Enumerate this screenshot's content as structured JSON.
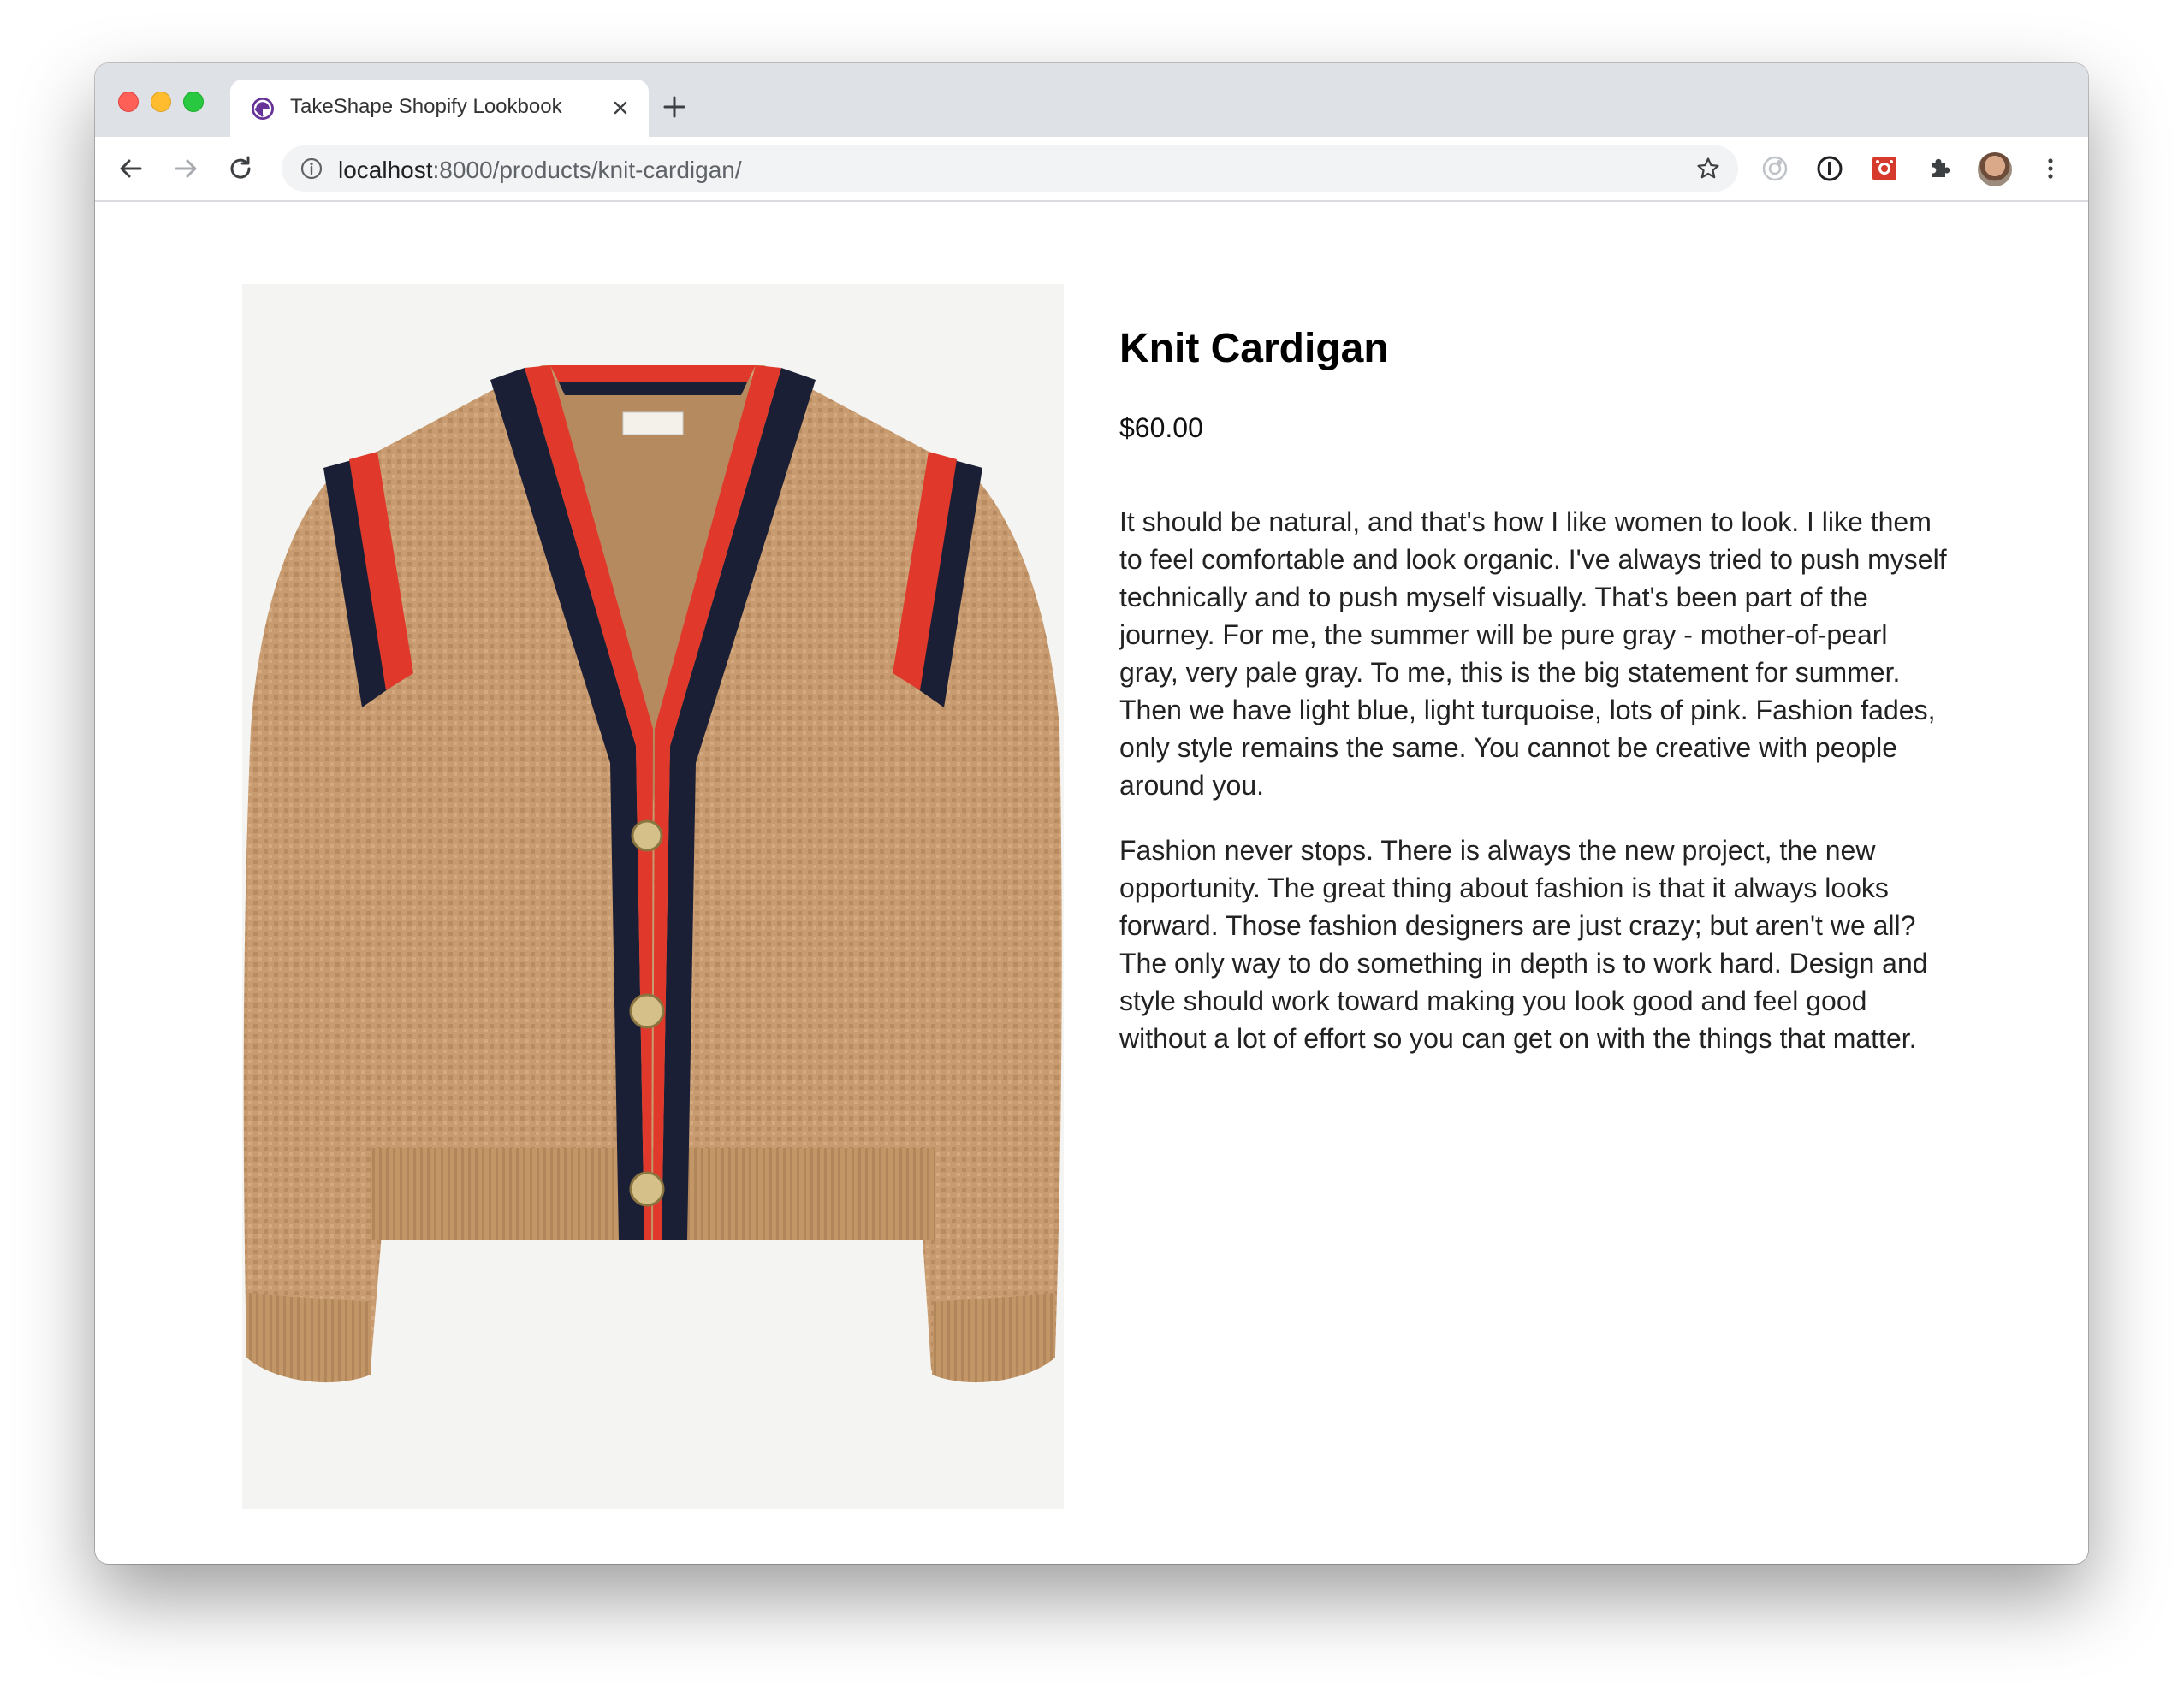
{
  "browser": {
    "tab_title": "TakeShape Shopify Lookbook",
    "url_host": "localhost",
    "url_rest": ":8000/products/knit-cardigan/"
  },
  "product": {
    "title": "Knit Cardigan",
    "price": "$60.00",
    "description": [
      "It should be natural, and that's how I like women to look. I like them to feel comfortable and look organic. I've always tried to push myself technically and to push myself visually. That's been part of the journey. For me, the summer will be pure gray - mother-of-pearl gray, very pale gray. To me, this is the big statement for summer. Then we have light blue, light turquoise, lots of pink. Fashion fades, only style remains the same. You cannot be creative with people around you.",
      "Fashion never stops. There is always the new project, the new opportunity. The great thing about fashion is that it always looks forward. Those fashion designers are just crazy; but aren't we all? The only way to do something in depth is to work hard. Design and style should work toward making you look good and feel good without a lot of effort so you can get on with the things that matter."
    ]
  },
  "colors": {
    "accent_red": "#e0392b",
    "navy": "#1b1f35",
    "camel": "#c89c70"
  }
}
